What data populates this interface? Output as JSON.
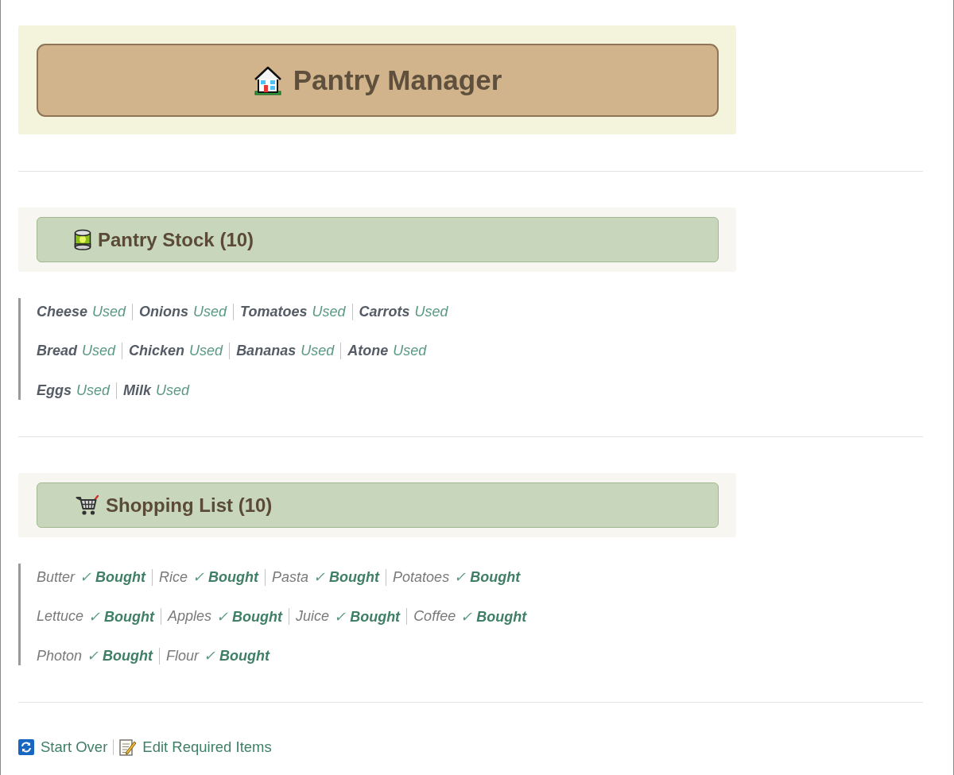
{
  "header": {
    "title": "Pantry Manager"
  },
  "sections": [
    {
      "kind": "stock",
      "title": "Pantry Stock (10)",
      "rows": [
        [
          {
            "name": "Cheese",
            "action": "Used"
          },
          {
            "name": "Onions",
            "action": "Used"
          },
          {
            "name": "Tomatoes",
            "action": "Used"
          },
          {
            "name": "Carrots",
            "action": "Used"
          }
        ],
        [
          {
            "name": "Bread",
            "action": "Used"
          },
          {
            "name": "Chicken",
            "action": "Used"
          },
          {
            "name": "Bananas",
            "action": "Used"
          },
          {
            "name": "Atone",
            "action": "Used"
          }
        ],
        [
          {
            "name": "Eggs",
            "action": "Used"
          },
          {
            "name": "Milk",
            "action": "Used"
          }
        ]
      ]
    },
    {
      "kind": "shopping",
      "title": "Shopping List (10)",
      "rows": [
        [
          {
            "name": "Butter",
            "action": "✓ **Bought**"
          },
          {
            "name": "Rice",
            "action": "✓ **Bought**"
          },
          {
            "name": "Pasta",
            "action": "✓ **Bought**"
          },
          {
            "name": "Potatoes",
            "action": "✓ **Bought**"
          }
        ],
        [
          {
            "name": "Lettuce",
            "action": "✓ **Bought**"
          },
          {
            "name": "Apples",
            "action": "✓ **Bought**"
          },
          {
            "name": "Juice",
            "action": "✓ **Bought**"
          },
          {
            "name": "Coffee",
            "action": "✓ **Bought**"
          }
        ],
        [
          {
            "name": "Photon",
            "action": "✓ **Bought**"
          },
          {
            "name": "Flour",
            "action": "✓ **Bought**"
          }
        ]
      ]
    }
  ],
  "footer": {
    "links": [
      {
        "kind": "refresh",
        "label": "Start Over"
      },
      {
        "kind": "edit",
        "label": "Edit Required Items"
      }
    ]
  }
}
